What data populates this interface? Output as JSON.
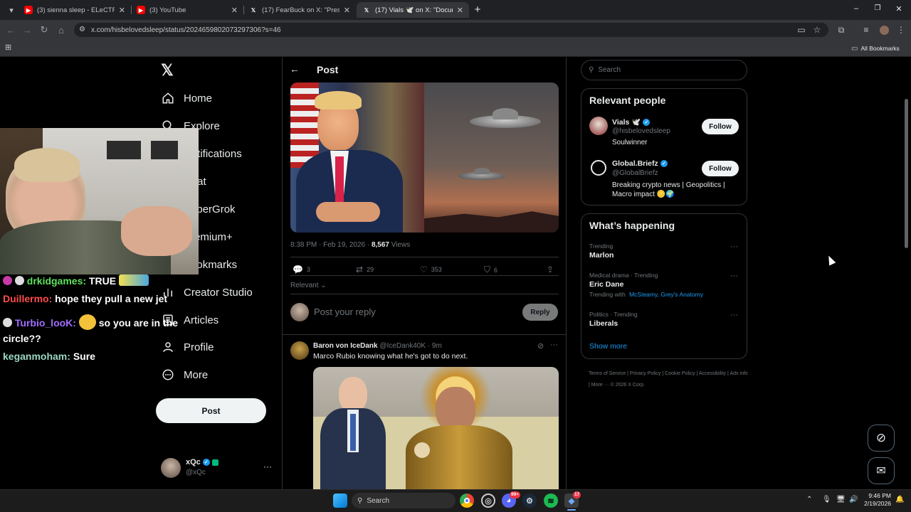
{
  "browser": {
    "tabs": [
      {
        "title": "(3) sienna sleep - ELeCTRA RAV",
        "icon": "youtube-icon"
      },
      {
        "title": "(3) YouTube",
        "icon": "youtube-icon"
      },
      {
        "title": "(17) FearBuck on X: \"President",
        "icon": "x-logo-icon"
      },
      {
        "title": "(17) Vials 🕊️ on X: \"Documente",
        "icon": "x-logo-icon"
      }
    ],
    "url": "x.com/hisbelovedsleep/status/2024659802073297306?s=46",
    "bookmarks_label": "All Bookmarks"
  },
  "nav": {
    "items": [
      {
        "label": "Home",
        "icon": "home-icon"
      },
      {
        "label": "Explore",
        "icon": "search-icon"
      },
      {
        "label": "Notifications",
        "icon": "bell-icon"
      },
      {
        "label": "Chat",
        "icon": "chat-icon"
      },
      {
        "label": "SuperGrok",
        "icon": "grok-icon"
      },
      {
        "label": "Premium+",
        "icon": "x-logo-icon"
      },
      {
        "label": "Bookmarks",
        "icon": "bookmark-icon"
      },
      {
        "label": "Creator Studio",
        "icon": "chart-icon"
      },
      {
        "label": "Articles",
        "icon": "article-icon"
      },
      {
        "label": "Profile",
        "icon": "person-icon"
      },
      {
        "label": "More",
        "icon": "more-circle-icon"
      }
    ],
    "post_label": "Post",
    "account": {
      "name": "xQc",
      "handle": "@xQc"
    }
  },
  "post": {
    "header": "Post",
    "timestamp": "8:38 PM · Feb 19, 2026 ·",
    "views_count": "8,567",
    "views_label": "Views",
    "replies": "3",
    "reposts": "29",
    "likes": "353",
    "bookmarks": "6",
    "sort_label": "Relevant",
    "reply_placeholder": "Post your reply",
    "reply_button": "Reply"
  },
  "reply": {
    "name": "Baron von IceDank",
    "handle": "@IceDank40K",
    "time": "· 9m",
    "text": "Marco Rubio knowing what he's got to do next."
  },
  "sidebar": {
    "search_placeholder": "Search",
    "relevant_title": "Relevant people",
    "people": [
      {
        "name": "Vials 🕊️",
        "handle": "@hisbelovedsleep",
        "bio": "Soulwinner",
        "follow": "Follow"
      },
      {
        "name": "Global.Briefz",
        "handle": "@GlobalBriefz",
        "bio": "Breaking crypto news | Geopolitics | Macro impact 🪙🌍",
        "follow": "Follow"
      }
    ],
    "happening_title": "What’s happening",
    "trends": [
      {
        "context": "Trending",
        "topic": "Marlon",
        "with_label": "",
        "with_links": ""
      },
      {
        "context": "Medical drama · Trending",
        "topic": "Eric Dane",
        "with_label": "Trending with",
        "with_links": "McSteamy, Grey's Anatomy"
      },
      {
        "context": "Politics · Trending",
        "topic": "Liberals",
        "with_label": "",
        "with_links": ""
      }
    ],
    "show_more": "Show more",
    "footer": [
      "Terms of Service",
      "Privacy Policy",
      "Cookie Policy",
      "Accessibility",
      "Ads info",
      "More ···",
      "© 2026 X Corp."
    ]
  },
  "chat": [
    {
      "user": "drkidgames:",
      "msg": "TRUE",
      "color": "#5ee35e"
    },
    {
      "user": "Duillermo:",
      "msg": "hope they pull a new jet",
      "color": "#ff4b4b"
    },
    {
      "user": "Turbio_looK:",
      "msg": "so you are in the",
      "color": "#a36cff"
    },
    {
      "user": "",
      "msg": "circle??",
      "color": "#ffffff"
    },
    {
      "user": "keganmoham:",
      "msg": "Sure",
      "color": "#9bd6c4"
    }
  ],
  "taskbar": {
    "search_label": "Search",
    "time": "9:46 PM",
    "date": "2/19/2026",
    "discord_badge": "99+",
    "app_badge": "17"
  },
  "colors": {
    "accent": "#1d9bf0",
    "verified": "#1d9bf0",
    "border": "#2f3336"
  }
}
